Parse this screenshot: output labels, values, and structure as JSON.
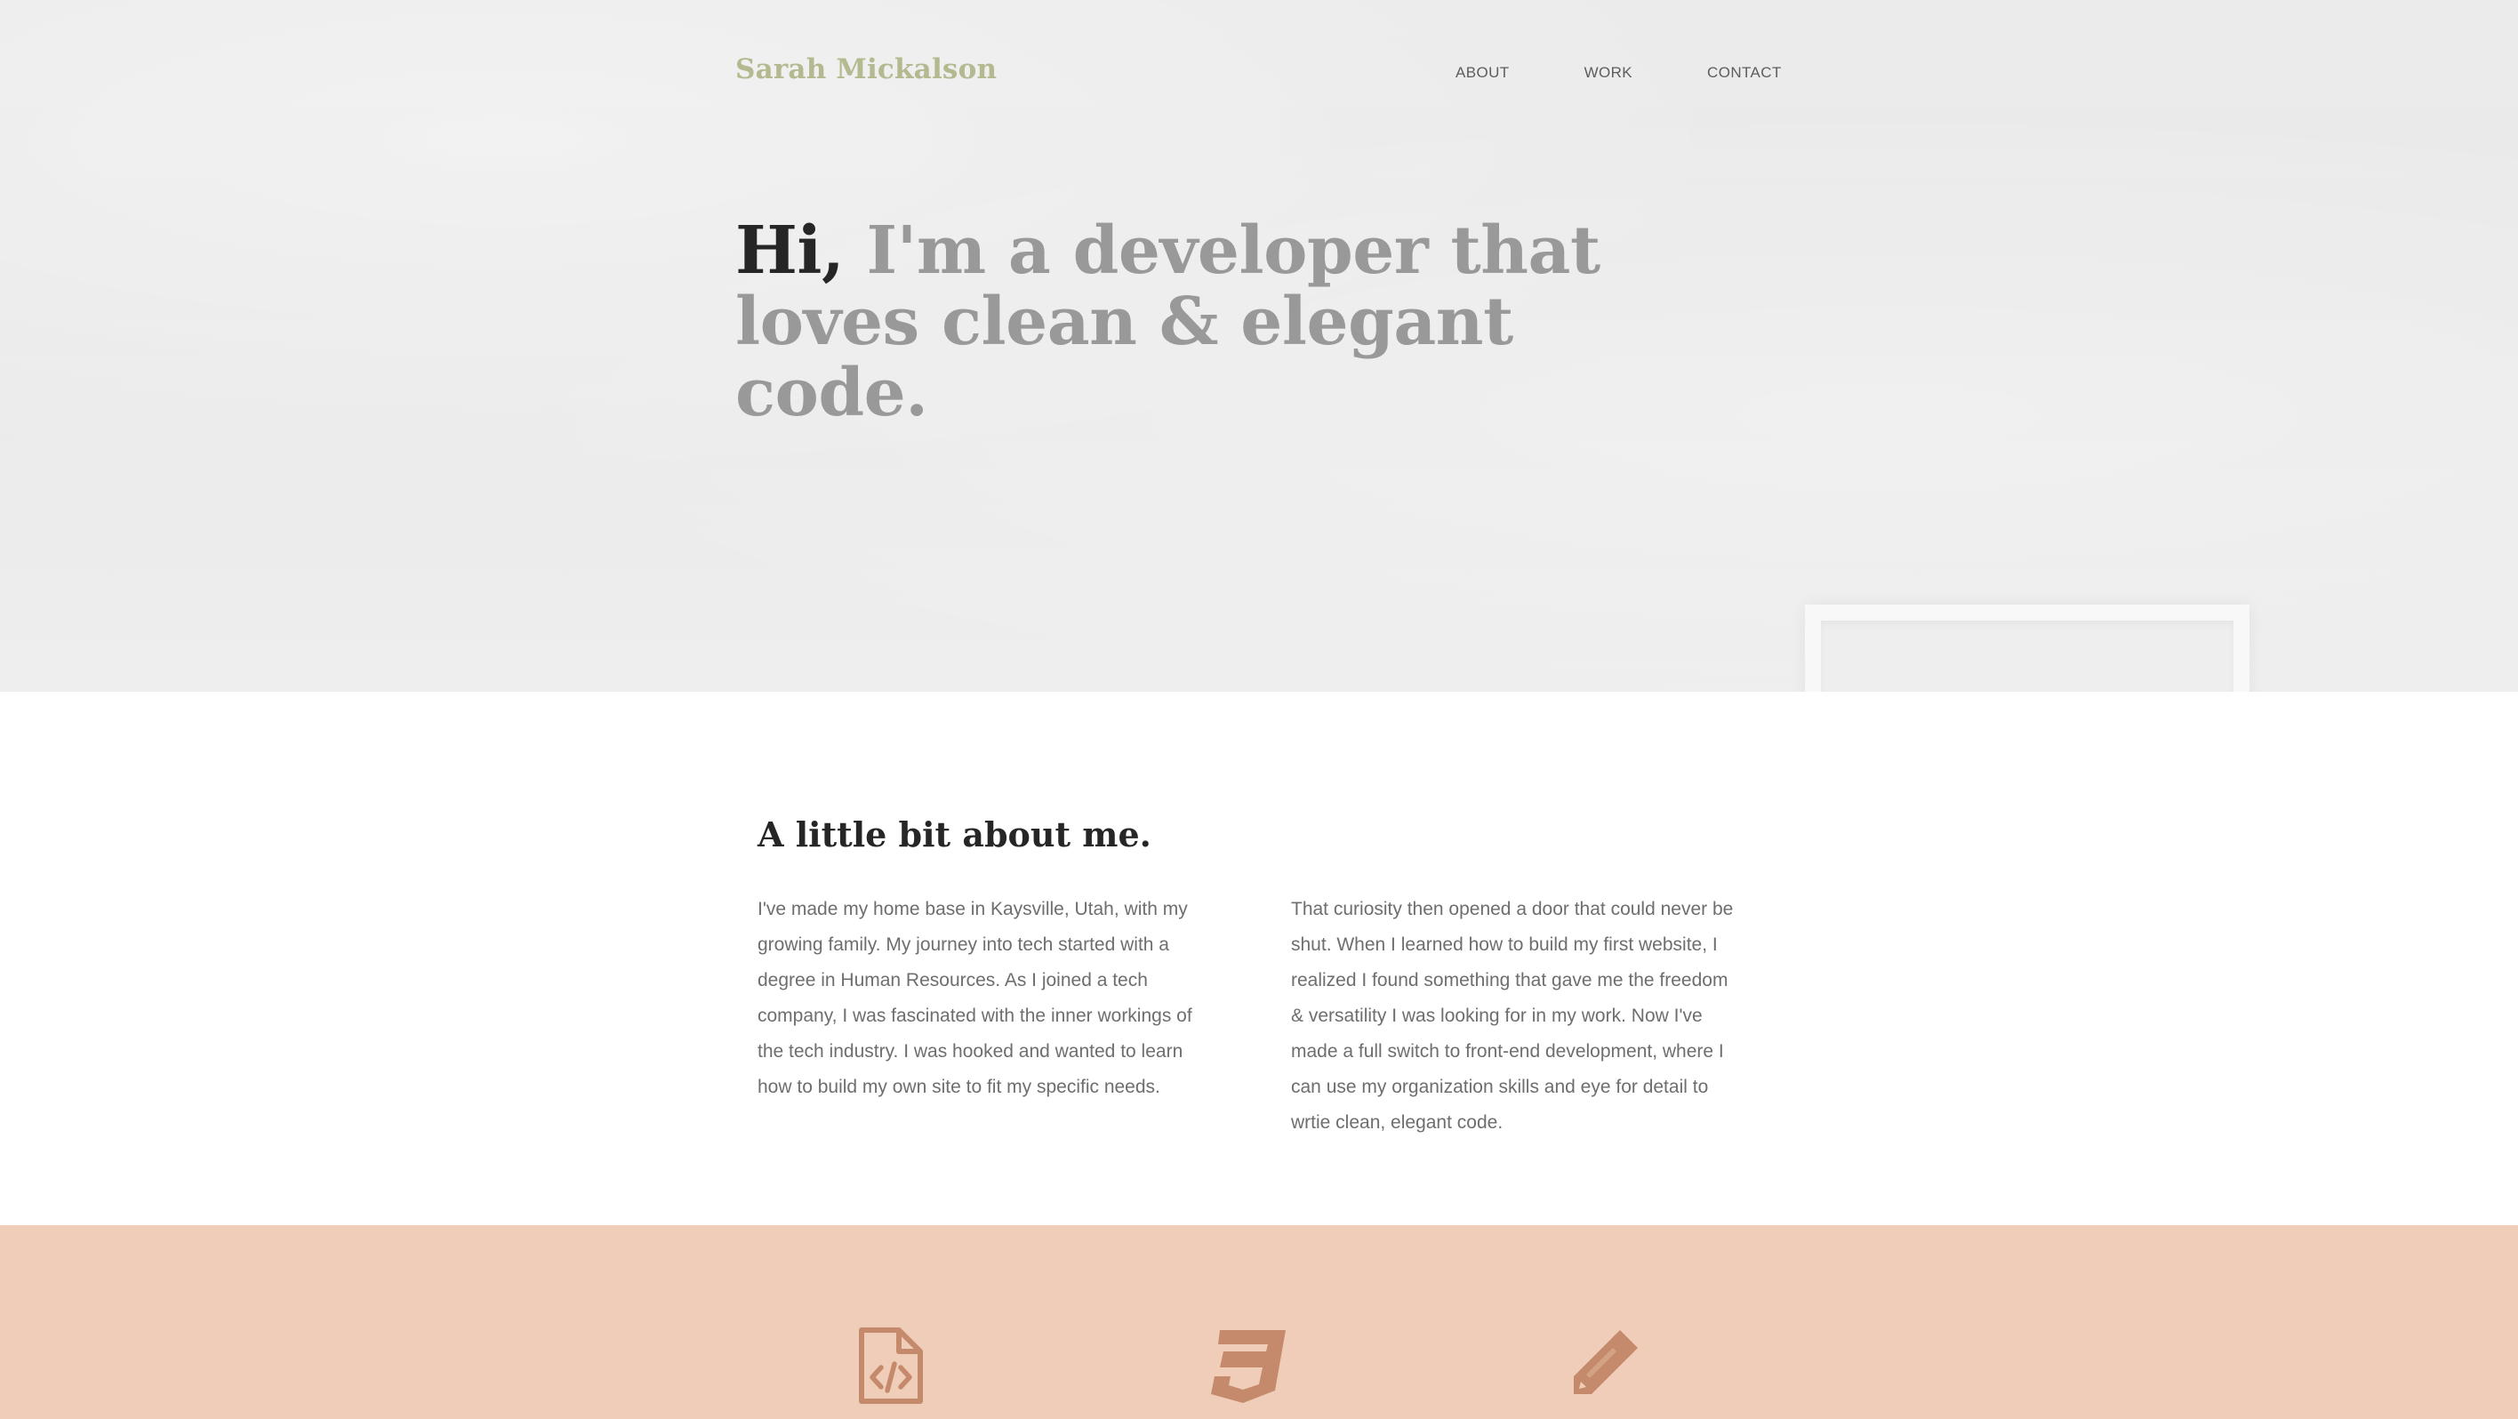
{
  "header": {
    "brand": "Sarah Mickalson",
    "nav": [
      "ABOUT",
      "WORK",
      "CONTACT"
    ]
  },
  "hero": {
    "greeting": "Hi,",
    "headline_rest": " I'm a developer that loves clean & elegant code."
  },
  "about": {
    "title": "A little bit about me.",
    "paragraph_left": "I've made my home base in Kaysville, Utah, with my growing family. My journey into tech started with a degree in Human Resources. As I joined a tech company, I was fascinated with the inner workings of the tech industry. I was hooked and wanted to learn how to build my own site to fit my specific needs.",
    "paragraph_right": "That curiosity then opened a door that could never be shut. When I learned how to build my first website, I realized I found something that gave me the freedom & versatility I was looking for in my work. Now I've made a full switch to front-end development, where I can use my organization skills and eye for detail to wrtie clean, elegant code."
  },
  "skills": {
    "icons": [
      "file-code-icon",
      "css3-icon",
      "pencil-icon"
    ]
  },
  "colors": {
    "brand": "#b5b98f",
    "headline_muted": "#999999",
    "headline_dark": "#262626",
    "skills_bg": "#f0cdb8",
    "icon": "#c48a6b"
  }
}
